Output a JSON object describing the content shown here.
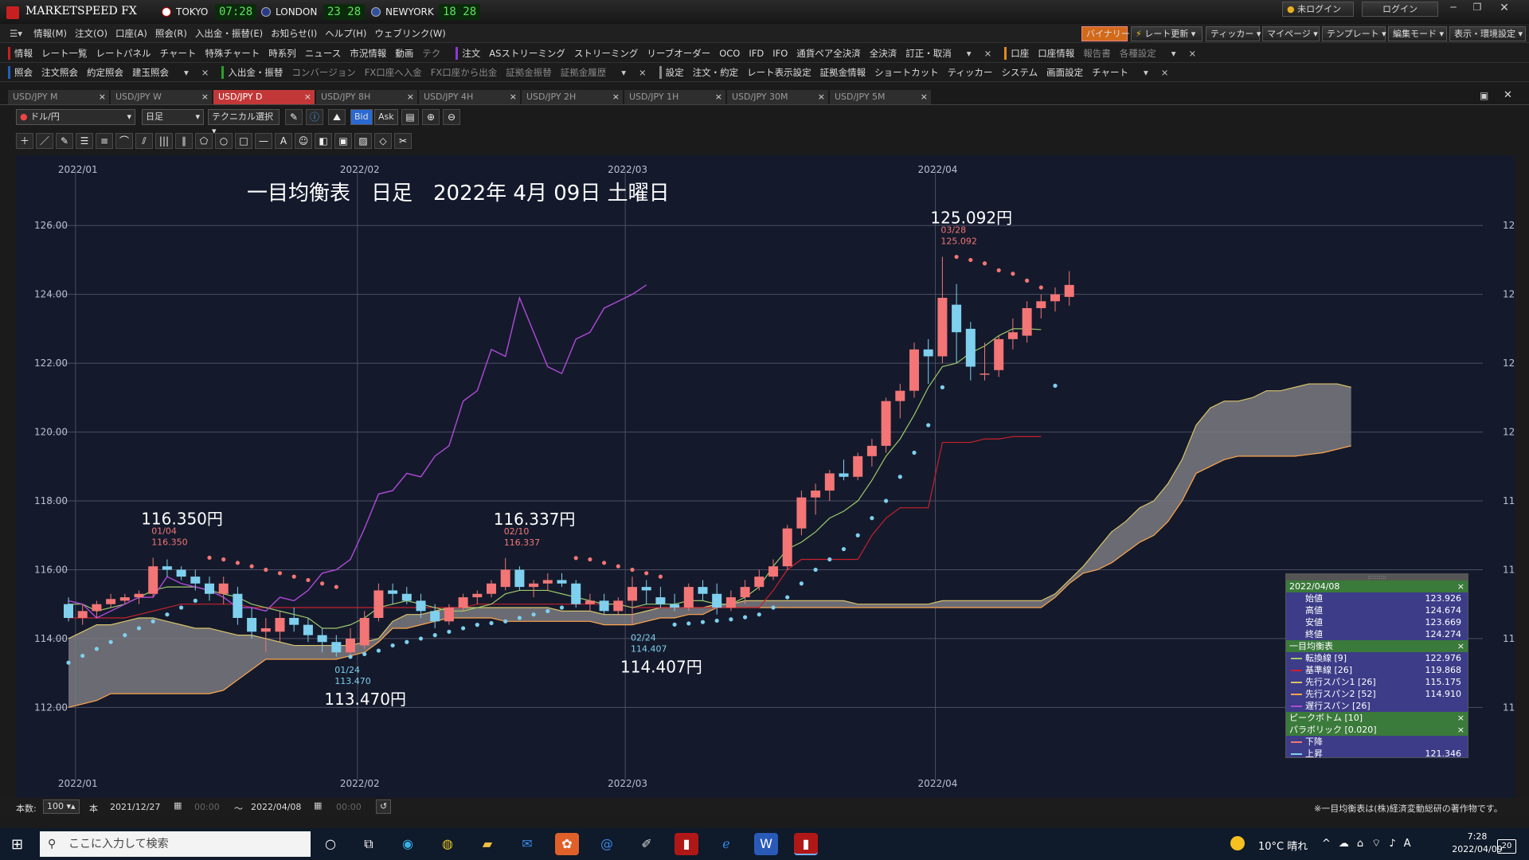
{
  "app": {
    "name": "MARKETSPEED FX",
    "cities": [
      {
        "name": "TOKYO",
        "time": "07:28"
      },
      {
        "name": "LONDON",
        "time": "23 28"
      },
      {
        "name": "NEWYORK",
        "time": "18 28"
      }
    ],
    "login_status": "未ログイン",
    "login_button": "ログイン"
  },
  "menu": [
    "情報(M)",
    "注文(O)",
    "口座(A)",
    "照会(R)",
    "入出金・振替(E)",
    "お知らせ(I)",
    "ヘルプ(H)",
    "ウェブリンク(W)"
  ],
  "top_buttons": [
    "バイナリー",
    "レート更新",
    "ティッカー",
    "マイページ",
    "テンプレート",
    "編集モード",
    "表示・環境設定"
  ],
  "toolbar1": {
    "group1": [
      "情報",
      "レート一覧",
      "レートパネル",
      "チャート",
      "特殊チャート",
      "時系列",
      "ニュース",
      "市況情報",
      "動画"
    ],
    "group1_dim": "テク",
    "group2": [
      "注文",
      "ASストリーミング",
      "ストリーミング",
      "リーブオーダー",
      "OCO",
      "IFD",
      "IFO",
      "通貨ペア全決済",
      "全決済",
      "訂正・取消"
    ],
    "group3": [
      "口座",
      "口座情報"
    ],
    "group3_dim": [
      "報告書",
      "各種設定"
    ]
  },
  "toolbar2": {
    "group1": [
      "照会",
      "注文照会",
      "約定照会",
      "建玉照会"
    ],
    "group2_active": "入出金・振替",
    "group2_dim": [
      "コンバージョン",
      "FX口座へ入金",
      "FX口座から出金",
      "証拠金振替",
      "証拠金履歴"
    ],
    "group3": [
      "設定",
      "注文・約定",
      "レート表示設定",
      "証拠金情報",
      "ショートカット",
      "ティッカー",
      "システム",
      "画面設定",
      "チャート"
    ]
  },
  "tabs": [
    "USD/JPY M",
    "USD/JPY W",
    "USD/JPY D",
    "USD/JPY 8H",
    "USD/JPY 4H",
    "USD/JPY 2H",
    "USD/JPY 1H",
    "USD/JPY 30M",
    "USD/JPY 5M"
  ],
  "active_tab": "USD/JPY D",
  "chart_toolbar": {
    "pair": "ドル/円",
    "period": "日足",
    "technical": "テクニカル選択",
    "bid": "Bid",
    "ask": "Ask"
  },
  "chart_data": {
    "type": "candlestick",
    "title": "一目均衡表　日足　2022年 4月 09日 土曜日",
    "ylim": [
      111.5,
      127.0
    ],
    "yticks": [
      "112.00",
      "114.00",
      "116.00",
      "118.00",
      "120.00",
      "122.00",
      "124.00",
      "126.00"
    ],
    "month_labels": [
      {
        "label": "2022/01",
        "index": 0.5
      },
      {
        "label": "2022/02",
        "index": 20.5
      },
      {
        "label": "2022/03",
        "index": 39.5
      },
      {
        "label": "2022/04",
        "index": 61.5
      }
    ],
    "candles": [
      {
        "o": 115.0,
        "h": 115.2,
        "l": 114.5,
        "c": 114.6
      },
      {
        "o": 114.6,
        "h": 115.0,
        "l": 114.4,
        "c": 114.8
      },
      {
        "o": 114.8,
        "h": 115.1,
        "l": 114.6,
        "c": 115.0
      },
      {
        "o": 115.0,
        "h": 115.3,
        "l": 114.9,
        "c": 115.15
      },
      {
        "o": 115.1,
        "h": 115.3,
        "l": 115.0,
        "c": 115.2
      },
      {
        "o": 115.2,
        "h": 115.4,
        "l": 115.0,
        "c": 115.3
      },
      {
        "o": 115.3,
        "h": 116.35,
        "l": 115.2,
        "c": 116.1
      },
      {
        "o": 116.1,
        "h": 116.3,
        "l": 115.8,
        "c": 116.0
      },
      {
        "o": 116.0,
        "h": 116.1,
        "l": 115.7,
        "c": 115.8
      },
      {
        "o": 115.8,
        "h": 116.0,
        "l": 115.4,
        "c": 115.6
      },
      {
        "o": 115.6,
        "h": 115.8,
        "l": 115.1,
        "c": 115.3
      },
      {
        "o": 115.3,
        "h": 115.8,
        "l": 115.0,
        "c": 115.6
      },
      {
        "o": 115.3,
        "h": 115.5,
        "l": 114.4,
        "c": 114.6
      },
      {
        "o": 114.6,
        "h": 114.9,
        "l": 114.0,
        "c": 114.2
      },
      {
        "o": 114.2,
        "h": 114.6,
        "l": 113.6,
        "c": 114.3
      },
      {
        "o": 114.2,
        "h": 114.8,
        "l": 113.9,
        "c": 114.6
      },
      {
        "o": 114.6,
        "h": 114.9,
        "l": 114.2,
        "c": 114.4
      },
      {
        "o": 114.4,
        "h": 114.6,
        "l": 113.9,
        "c": 114.1
      },
      {
        "o": 114.1,
        "h": 114.3,
        "l": 113.6,
        "c": 113.9
      },
      {
        "o": 113.9,
        "h": 114.1,
        "l": 113.47,
        "c": 113.6
      },
      {
        "o": 113.6,
        "h": 114.3,
        "l": 113.5,
        "c": 114.0
      },
      {
        "o": 113.8,
        "h": 114.8,
        "l": 113.7,
        "c": 114.6
      },
      {
        "o": 114.6,
        "h": 115.6,
        "l": 114.5,
        "c": 115.4
      },
      {
        "o": 115.4,
        "h": 115.6,
        "l": 115.0,
        "c": 115.3
      },
      {
        "o": 115.3,
        "h": 115.5,
        "l": 115.0,
        "c": 115.1
      },
      {
        "o": 115.1,
        "h": 115.3,
        "l": 114.6,
        "c": 114.8
      },
      {
        "o": 114.8,
        "h": 115.0,
        "l": 114.3,
        "c": 114.5
      },
      {
        "o": 114.5,
        "h": 115.0,
        "l": 114.4,
        "c": 114.9
      },
      {
        "o": 114.9,
        "h": 115.3,
        "l": 114.8,
        "c": 115.2
      },
      {
        "o": 115.2,
        "h": 115.4,
        "l": 115.0,
        "c": 115.3
      },
      {
        "o": 115.3,
        "h": 115.7,
        "l": 115.2,
        "c": 115.6
      },
      {
        "o": 115.5,
        "h": 116.34,
        "l": 115.4,
        "c": 116.0
      },
      {
        "o": 116.0,
        "h": 116.1,
        "l": 115.4,
        "c": 115.5
      },
      {
        "o": 115.5,
        "h": 115.7,
        "l": 115.2,
        "c": 115.6
      },
      {
        "o": 115.6,
        "h": 115.9,
        "l": 115.4,
        "c": 115.7
      },
      {
        "o": 115.7,
        "h": 115.9,
        "l": 115.5,
        "c": 115.6
      },
      {
        "o": 115.6,
        "h": 115.7,
        "l": 114.9,
        "c": 115.0
      },
      {
        "o": 115.0,
        "h": 115.3,
        "l": 114.8,
        "c": 115.1
      },
      {
        "o": 115.1,
        "h": 115.3,
        "l": 114.7,
        "c": 114.8
      },
      {
        "o": 114.8,
        "h": 115.2,
        "l": 114.7,
        "c": 115.1
      },
      {
        "o": 115.1,
        "h": 115.8,
        "l": 114.407,
        "c": 115.5
      },
      {
        "o": 115.5,
        "h": 115.7,
        "l": 115.0,
        "c": 115.4
      },
      {
        "o": 115.2,
        "h": 115.5,
        "l": 114.9,
        "c": 115.0
      },
      {
        "o": 115.0,
        "h": 115.3,
        "l": 114.8,
        "c": 114.9
      },
      {
        "o": 114.9,
        "h": 115.6,
        "l": 114.8,
        "c": 115.5
      },
      {
        "o": 115.5,
        "h": 115.7,
        "l": 115.1,
        "c": 115.3
      },
      {
        "o": 115.3,
        "h": 115.6,
        "l": 114.7,
        "c": 114.9
      },
      {
        "o": 114.9,
        "h": 115.4,
        "l": 114.8,
        "c": 115.2
      },
      {
        "o": 115.2,
        "h": 115.7,
        "l": 115.0,
        "c": 115.5
      },
      {
        "o": 115.5,
        "h": 116.0,
        "l": 115.4,
        "c": 115.8
      },
      {
        "o": 115.8,
        "h": 116.3,
        "l": 115.7,
        "c": 116.1
      },
      {
        "o": 116.1,
        "h": 117.3,
        "l": 116.0,
        "c": 117.2
      },
      {
        "o": 117.2,
        "h": 118.3,
        "l": 117.0,
        "c": 118.1
      },
      {
        "o": 118.1,
        "h": 118.5,
        "l": 117.6,
        "c": 118.3
      },
      {
        "o": 118.3,
        "h": 118.9,
        "l": 118.0,
        "c": 118.8
      },
      {
        "o": 118.8,
        "h": 119.2,
        "l": 118.6,
        "c": 118.7
      },
      {
        "o": 118.7,
        "h": 119.4,
        "l": 118.6,
        "c": 119.3
      },
      {
        "o": 119.3,
        "h": 119.8,
        "l": 119.0,
        "c": 119.6
      },
      {
        "o": 119.6,
        "h": 121.0,
        "l": 119.4,
        "c": 120.9
      },
      {
        "o": 120.9,
        "h": 121.4,
        "l": 120.4,
        "c": 121.2
      },
      {
        "o": 121.2,
        "h": 122.6,
        "l": 121.0,
        "c": 122.4
      },
      {
        "o": 122.4,
        "h": 122.7,
        "l": 121.4,
        "c": 122.2
      },
      {
        "o": 122.2,
        "h": 125.092,
        "l": 122.0,
        "c": 123.9
      },
      {
        "o": 123.7,
        "h": 124.3,
        "l": 122.0,
        "c": 122.9
      },
      {
        "o": 123.0,
        "h": 123.2,
        "l": 121.5,
        "c": 121.9
      },
      {
        "o": 121.7,
        "h": 122.6,
        "l": 121.5,
        "c": 121.7
      },
      {
        "o": 121.8,
        "h": 122.8,
        "l": 121.6,
        "c": 122.7
      },
      {
        "o": 122.7,
        "h": 123.3,
        "l": 122.4,
        "c": 122.9
      },
      {
        "o": 122.8,
        "h": 123.8,
        "l": 122.6,
        "c": 123.6
      },
      {
        "o": 123.6,
        "h": 124.0,
        "l": 123.3,
        "c": 123.8
      },
      {
        "o": 123.8,
        "h": 124.2,
        "l": 123.5,
        "c": 124.0
      },
      {
        "o": 123.926,
        "h": 124.674,
        "l": 123.669,
        "c": 124.274
      }
    ],
    "tenkan": [
      115.0,
      115.0,
      114.8,
      114.9,
      115.0,
      115.2,
      115.4,
      115.5,
      115.5,
      115.5,
      115.4,
      115.3,
      115.2,
      115.0,
      114.9,
      114.8,
      114.7,
      114.6,
      114.3,
      114.3,
      114.4,
      114.6,
      114.9,
      115.0,
      115.1,
      115.0,
      114.9,
      114.8,
      114.8,
      114.9,
      115.0,
      115.3,
      115.4,
      115.4,
      115.4,
      115.3,
      115.2,
      115.1,
      115.0,
      115.0,
      114.9,
      115.0,
      115.0,
      115.0,
      115.1,
      115.1,
      115.0,
      115.0,
      115.2,
      115.5,
      116.1,
      116.6,
      116.8,
      117.1,
      117.5,
      117.7,
      118.0,
      118.6,
      119.3,
      119.8,
      120.5,
      121.3,
      121.9,
      122.0,
      122.3,
      122.5,
      122.8,
      123.0,
      123.0,
      122.976
    ],
    "kijun": [
      114.6,
      114.6,
      114.6,
      114.6,
      114.6,
      114.7,
      114.8,
      114.9,
      115.0,
      115.0,
      115.0,
      115.0,
      115.0,
      114.9,
      114.9,
      114.9,
      114.9,
      114.9,
      114.9,
      114.9,
      114.9,
      114.9,
      114.9,
      114.9,
      114.9,
      114.9,
      114.9,
      114.9,
      114.9,
      115.0,
      115.0,
      115.0,
      115.0,
      115.0,
      115.0,
      115.0,
      115.0,
      115.0,
      115.0,
      115.0,
      114.9,
      114.9,
      114.9,
      114.9,
      114.9,
      114.9,
      114.9,
      114.9,
      114.9,
      114.9,
      115.4,
      116.0,
      116.3,
      116.3,
      116.3,
      116.3,
      116.3,
      117.0,
      117.5,
      117.8,
      117.8,
      117.8,
      119.7,
      119.7,
      119.7,
      119.8,
      119.8,
      119.868,
      119.868,
      119.868
    ],
    "chikou_start": 0,
    "chikou": [
      115.1,
      115.0,
      114.6,
      114.8,
      115.0,
      115.2,
      115.2,
      115.8,
      115.6,
      115.5,
      115.4,
      115.2,
      114.9,
      114.9,
      114.8,
      115.2,
      115.1,
      115.4,
      115.9,
      116.0,
      116.3,
      117.2,
      118.2,
      118.3,
      118.8,
      118.7,
      119.3,
      119.6,
      120.9,
      121.2,
      122.4,
      122.2,
      123.9,
      122.9,
      121.9,
      121.7,
      122.7,
      122.9,
      123.6,
      123.8,
      124.0,
      124.274
    ],
    "senkou_offset": 0,
    "senkou_a": [
      114.0,
      114.2,
      114.4,
      114.4,
      114.5,
      114.6,
      114.6,
      114.5,
      114.4,
      114.3,
      114.3,
      114.2,
      114.1,
      114.1,
      114.0,
      113.9,
      113.8,
      113.8,
      113.8,
      113.8,
      113.8,
      113.9,
      114.0,
      114.5,
      114.7,
      114.7,
      114.8,
      114.9,
      114.9,
      114.9,
      114.9,
      114.9,
      114.9,
      114.9,
      114.9,
      114.8,
      114.8,
      114.8,
      114.7,
      114.7,
      114.7,
      114.8,
      114.9,
      114.9,
      114.9,
      114.9,
      115.0,
      115.0,
      115.1,
      115.1,
      115.1,
      115.1,
      115.1,
      115.1,
      115.1,
      115.1,
      115.0,
      115.0,
      115.0,
      115.0,
      115.0,
      115.0,
      115.1,
      115.1,
      115.1,
      115.1,
      115.1,
      115.1,
      115.1,
      115.1,
      115.3,
      115.7,
      116.1,
      116.6,
      117.1,
      117.4,
      117.8,
      118.0,
      118.5,
      119.2,
      120.2,
      120.7,
      120.9,
      120.9,
      121.0,
      121.2,
      121.2,
      121.3,
      121.4,
      121.4,
      121.4,
      121.3
    ],
    "senkou_b": [
      112.0,
      112.1,
      112.2,
      112.4,
      112.4,
      112.4,
      112.4,
      112.4,
      112.4,
      112.4,
      112.4,
      112.5,
      112.8,
      113.1,
      113.4,
      113.4,
      113.4,
      113.4,
      113.4,
      113.4,
      113.5,
      113.6,
      113.9,
      114.3,
      114.3,
      114.4,
      114.5,
      114.6,
      114.6,
      114.6,
      114.6,
      114.5,
      114.5,
      114.5,
      114.5,
      114.5,
      114.5,
      114.5,
      114.4,
      114.4,
      114.4,
      114.5,
      114.6,
      114.6,
      114.7,
      114.7,
      114.9,
      114.9,
      114.9,
      114.9,
      114.9,
      114.9,
      114.9,
      114.9,
      114.9,
      114.9,
      114.9,
      114.9,
      114.9,
      114.9,
      114.9,
      114.9,
      114.9,
      114.9,
      114.9,
      114.9,
      114.9,
      114.9,
      114.9,
      114.9,
      115.2,
      115.6,
      115.9,
      116.0,
      116.2,
      116.5,
      116.8,
      117.0,
      117.4,
      118.0,
      118.8,
      119.0,
      119.2,
      119.3,
      119.3,
      119.3,
      119.3,
      119.3,
      119.35,
      119.4,
      119.5,
      119.6
    ],
    "psar": [
      113.3,
      113.5,
      113.7,
      113.9,
      114.1,
      114.3,
      114.5,
      114.7,
      114.9,
      115.1,
      116.35,
      116.3,
      116.2,
      116.1,
      116.0,
      115.9,
      115.8,
      115.7,
      115.6,
      115.5,
      113.47,
      113.55,
      113.65,
      113.8,
      113.9,
      114.0,
      114.1,
      114.2,
      114.3,
      114.4,
      114.45,
      114.5,
      114.6,
      114.7,
      114.8,
      114.9,
      116.34,
      116.3,
      116.2,
      116.1,
      116.0,
      115.9,
      115.8,
      114.407,
      114.44,
      114.48,
      114.52,
      114.56,
      114.62,
      114.7,
      114.9,
      115.2,
      115.6,
      116.0,
      116.3,
      116.6,
      117.0,
      117.5,
      118.0,
      118.7,
      119.4,
      120.2,
      121.3,
      125.09,
      125.0,
      124.9,
      124.7,
      124.6,
      124.4,
      124.2,
      121.346
    ],
    "peaks": [
      {
        "index": 6,
        "type": "high",
        "date": "01/04",
        "value": "116.350",
        "big": "116.350円"
      },
      {
        "index": 19,
        "type": "low",
        "date": "01/24",
        "value": "113.470",
        "big": "113.470円"
      },
      {
        "index": 31,
        "type": "high",
        "date": "02/10",
        "value": "116.337",
        "big": "116.337円"
      },
      {
        "index": 40,
        "type": "low",
        "date": "02/24",
        "value": "114.407",
        "big": "114.407円"
      },
      {
        "index": 62,
        "type": "high",
        "date": "03/28",
        "value": "125.092",
        "big": "125.092円"
      }
    ],
    "colors": {
      "up": "#f37575",
      "down": "#7fd0ee",
      "tenkan": "#9ec86a",
      "kijun": "#c8202c",
      "chikou": "#b04ad8",
      "spanA": "#d8c36a",
      "spanB": "#ffa64d",
      "cloud": "#7a7a80",
      "psar_up": "#7fd0ee",
      "psar_down": "#f37575",
      "grid": "#4a5060",
      "text": "#b8c0d0"
    }
  },
  "legend": {
    "date": "2022/04/08",
    "ohlc": [
      {
        "label": "始値",
        "value": "123.926"
      },
      {
        "label": "高値",
        "value": "124.674"
      },
      {
        "label": "安値",
        "value": "123.669"
      },
      {
        "label": "終値",
        "value": "124.274"
      }
    ],
    "ichimoku_title": "一目均衡表",
    "ichimoku": [
      {
        "label": "転換線 [9]",
        "value": "122.976",
        "color": "#9ec86a"
      },
      {
        "label": "基準線 [26]",
        "value": "119.868",
        "color": "#c8202c"
      },
      {
        "label": "先行スパン1 [26]",
        "value": "115.175",
        "color": "#d8c36a"
      },
      {
        "label": "先行スパン2 [52]",
        "value": "114.910",
        "color": "#ffa64d"
      },
      {
        "label": "遅行スパン [26]",
        "value": "",
        "color": "#b04ad8"
      }
    ],
    "peak_title": "ピークボトム [10]",
    "psar_title": "パラボリック [0.020]",
    "psar": [
      {
        "label": "下降",
        "value": "",
        "color": "#f37575"
      },
      {
        "label": "上昇",
        "value": "121.346",
        "color": "#7fd0ee"
      }
    ]
  },
  "statusbar": {
    "count_label": "本数:",
    "count": "100",
    "unit": "本",
    "from": "2021/12/27",
    "from_time": "00:00",
    "tilde": "〜",
    "to": "2022/04/08",
    "to_time": "00:00",
    "copyright": "※一目均衡表は(株)経済変動総研の著作物です。"
  },
  "taskbar": {
    "search": "ここに入力して検索",
    "weather": "10°C 晴れ",
    "time": "7:28",
    "date": "2022/04/09",
    "badge": "20"
  }
}
